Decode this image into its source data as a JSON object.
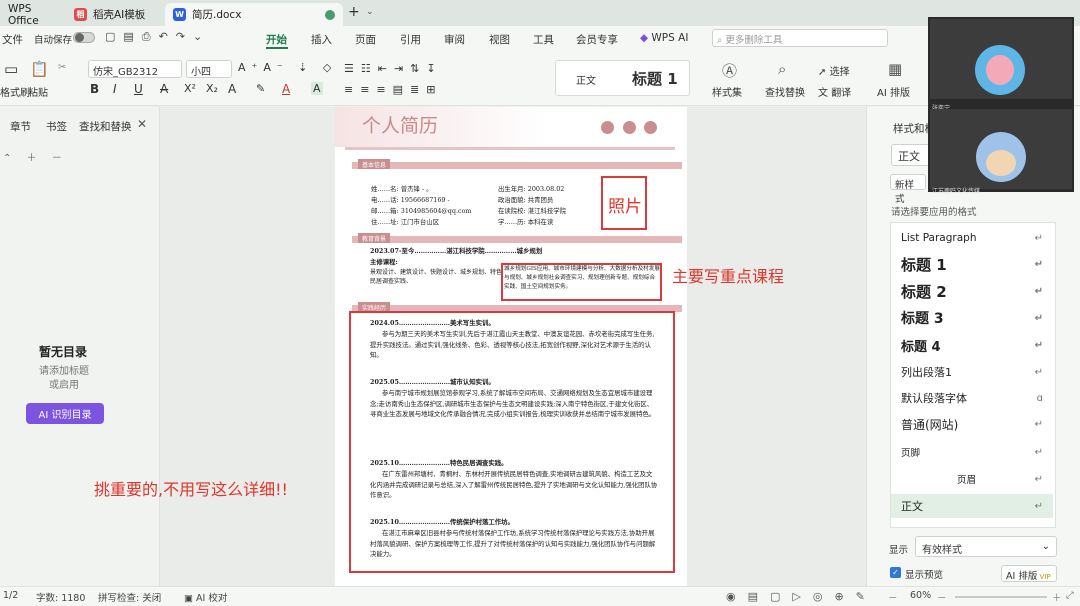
{
  "tabs": {
    "home": "WPS Office",
    "template": "稻壳AI模板",
    "document": "简历.docx",
    "new_tab": "+"
  },
  "menubar": {
    "file": "文件",
    "autosave": "自动保存",
    "items": [
      "开始",
      "插入",
      "页面",
      "引用",
      "审阅",
      "视图",
      "工具",
      "会员专享",
      "WPS AI"
    ],
    "search_placeholder": "更多删除工具"
  },
  "ribbon": {
    "format_painter": "格式刷",
    "paste": "粘贴",
    "font_name": "仿宋_GB2312",
    "font_size": "小四",
    "style_normal": "正文",
    "style_heading1": "标题 1",
    "style_set": "样式集",
    "find_replace": "查找替换",
    "select": "选择",
    "translate": "翻译",
    "ai_layout": "AI 排版"
  },
  "left_panel": {
    "tabs": [
      "章节",
      "书签",
      "查找和替换"
    ],
    "empty_title": "暂无目录",
    "empty_hint_1": "请添加标题",
    "empty_hint_2": "或启用",
    "ai_button": "AI 识别目录"
  },
  "right_panel": {
    "title": "样式和格式",
    "current_style": "正文",
    "new_style": "新样式",
    "apply_label": "请选择要应用的格式",
    "styles": [
      "List Paragraph",
      "标题 1",
      "标题 2",
      "标题 3",
      "标题 4",
      "列出段落1",
      "默认段落字体",
      "普通(网站)",
      "页脚",
      "页眉",
      "正文"
    ],
    "show_label": "显示",
    "show_value": "有效样式",
    "preview_label": "显示预览",
    "ai_layout": "AI 排版"
  },
  "status": {
    "page": "1/2",
    "words": "字数: 1180",
    "spell": "拼写检查: 关闭",
    "ai_check": "AI 校对",
    "zoom": "60%"
  },
  "resume": {
    "title": "个人简历",
    "sec_basic": "基本信息",
    "sec_edu": "教育背景",
    "sec_practice": "实践经历",
    "photo": "照片",
    "basic_left": [
      "姓……名: 曾杰锋 - 。",
      "电……话: 19566687169 -",
      "邮……箱: 3104985604@qq.com",
      "住……址: 江门市台山区"
    ],
    "basic_right": [
      "出生年月: 2003.08.02",
      "政治面貌: 共青团员",
      "在读院校: 湛江科技学院",
      "学……历: 本科在读"
    ],
    "edu_line": "2023.07-至今……………湛江科技学院……………城乡规划",
    "edu_course_label": "主修课程:",
    "edu_courses_left": "景观设计、建筑设计、快题设计、城乡规划、特色民居调查实践、",
    "edu_courses_right": "城乡规划GIS应用、城市环境建模与分析、大数据分析及村发展与规划、城乡规划社会调查实习、规划理创新专题、规划综合实践、国土空间规划实务。",
    "exp": [
      {
        "head": "2024.05……………………美术写生实训。",
        "body": "参与为期三天的美术写生实训,先后于湛江霞山天主教堂、中澳友谊花园、赤坎老街完成写生任务,提升实践技法。通过实训,强化线条、色彩、透视等核心技法,拓宽创作视野,深化对艺术源于生活的认知。"
      },
      {
        "head": "2025.05……………………城市认知实训。",
        "body": "参与南宁城市规划展览馆参观学习,系统了解城市空间布局、交通网络规划及生态宜居城市建设理念;走访南秀山生态保护区,调研城市生态保护与生态文明建设实践;深入南宁特色街区,于建文化街区、寻商业生态发展与地域文化传承融合情况,完成小组实训报告,梳理实训收获并总结南宁城市发展特色。"
      },
      {
        "head": "2025.10……………………特色民居调查实践。",
        "body": "在广东雷州邦塘村、青桐村、东林村开展传统民居特色调查,实地调研古建筑风貌、构造工艺及文化内涵并完成调研记录与总结,深入了解雷州传统民居特色,提升了实地调研与文化认知能力,强化团队协作意识。"
      },
      {
        "head": "2025.10……………………传统保护村落工作坊。",
        "body": "在湛江市麻章区旧县村参与传统村落保护工作坊,系统学习传统村落保护理论与实践方法,协助开展村落风貌调研、保护方案梳理等工作,提升了对传统村落保护的认知与实践能力,强化团队协作与问题解决能力。"
      }
    ]
  },
  "annotations": {
    "photo_note": "照片",
    "course_note": "主要写重点课程",
    "detail_note": "挑重要的,不用写这么详细!!"
  },
  "video": {
    "user1": "张奕宁",
    "user2": "江苏鹿鸣文化传媒"
  }
}
